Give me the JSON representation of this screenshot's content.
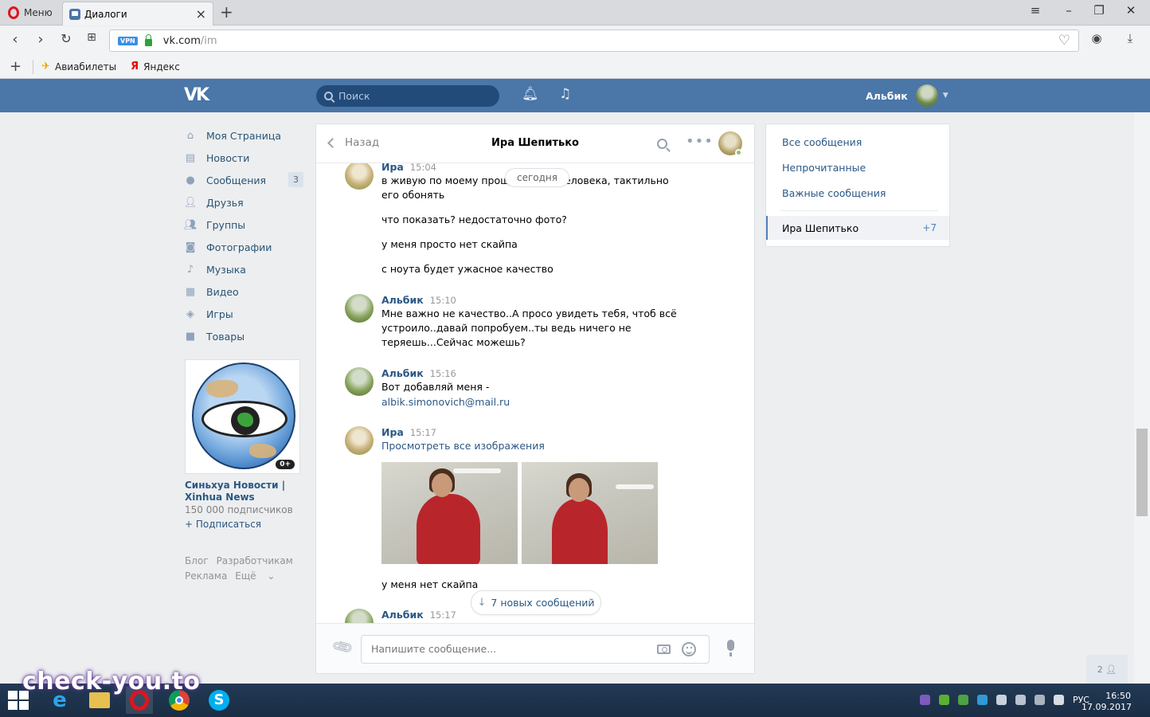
{
  "browser": {
    "menu_label": "Меню",
    "tab_title": "Диалоги",
    "url_host": "vk.com",
    "url_path": "/im",
    "vpn_label": "VPN",
    "bookmarks": [
      "Авиабилеты",
      "Яндекс"
    ]
  },
  "vk": {
    "logo": "VK",
    "search_placeholder": "Поиск",
    "user_name": "Альбик"
  },
  "nav": {
    "items": [
      {
        "label": "Моя Страница",
        "icon": "home-icon"
      },
      {
        "label": "Новости",
        "icon": "news-icon"
      },
      {
        "label": "Сообщения",
        "icon": "messages-icon",
        "badge": "3"
      },
      {
        "label": "Друзья",
        "icon": "friends-icon"
      },
      {
        "label": "Группы",
        "icon": "groups-icon"
      },
      {
        "label": "Фотографии",
        "icon": "camera-icon"
      },
      {
        "label": "Музыка",
        "icon": "music-icon"
      },
      {
        "label": "Видео",
        "icon": "video-icon"
      },
      {
        "label": "Игры",
        "icon": "gamepad-icon"
      },
      {
        "label": "Товары",
        "icon": "bag-icon"
      }
    ]
  },
  "promo": {
    "age_badge": "0+",
    "name": "Синьхуа Новости | Xinhua News",
    "subscribers": "150 000 подписчиков",
    "subscribe_label": "+ Подписаться"
  },
  "footer": {
    "links": [
      "Блог",
      "Разработчикам",
      "Реклама",
      "Ещё"
    ]
  },
  "chat": {
    "back_label": "Назад",
    "title": "Ира Шепитько",
    "today_label": "сегодня",
    "new_messages_label": "7 новых сообщений",
    "composer_placeholder": "Напишите сообщение...",
    "messages": [
      {
        "author": "Ира",
        "time": "15:04",
        "lines": [
          "в живую по моему проще понять человека, тактильно его обонять",
          "что показать? недостаточно фото?",
          "у меня просто нет скайпа",
          "с ноута будет ужасное качество"
        ]
      },
      {
        "author": "Альбик",
        "time": "15:10",
        "lines": [
          "Мне важно не качество..А просо увидеть тебя, чтоб всё устроило..давай попробуем..ты ведь ничего не теряешь...Сейчас можешь?"
        ]
      },
      {
        "author": "Альбик",
        "time": "15:16",
        "lines": [
          "Вот добавляй меня -"
        ],
        "link": "albik.simonovich@mail.ru"
      },
      {
        "author": "Ира",
        "time": "15:17",
        "link": "Просмотреть все изображения",
        "lines": [
          "у меня нет скайпа"
        ]
      },
      {
        "author": "Альбик",
        "time": "15:17"
      }
    ]
  },
  "filters": {
    "items": [
      "Все сообщения",
      "Непрочитанные",
      "Важные сообщения"
    ],
    "active": {
      "name": "Ира Шепитько",
      "count": "+7"
    }
  },
  "minichat_count": "2",
  "taskbar": {
    "lang": "РУС",
    "time": "16:50",
    "date": "17.09.2017"
  },
  "watermark": "check-you.to"
}
